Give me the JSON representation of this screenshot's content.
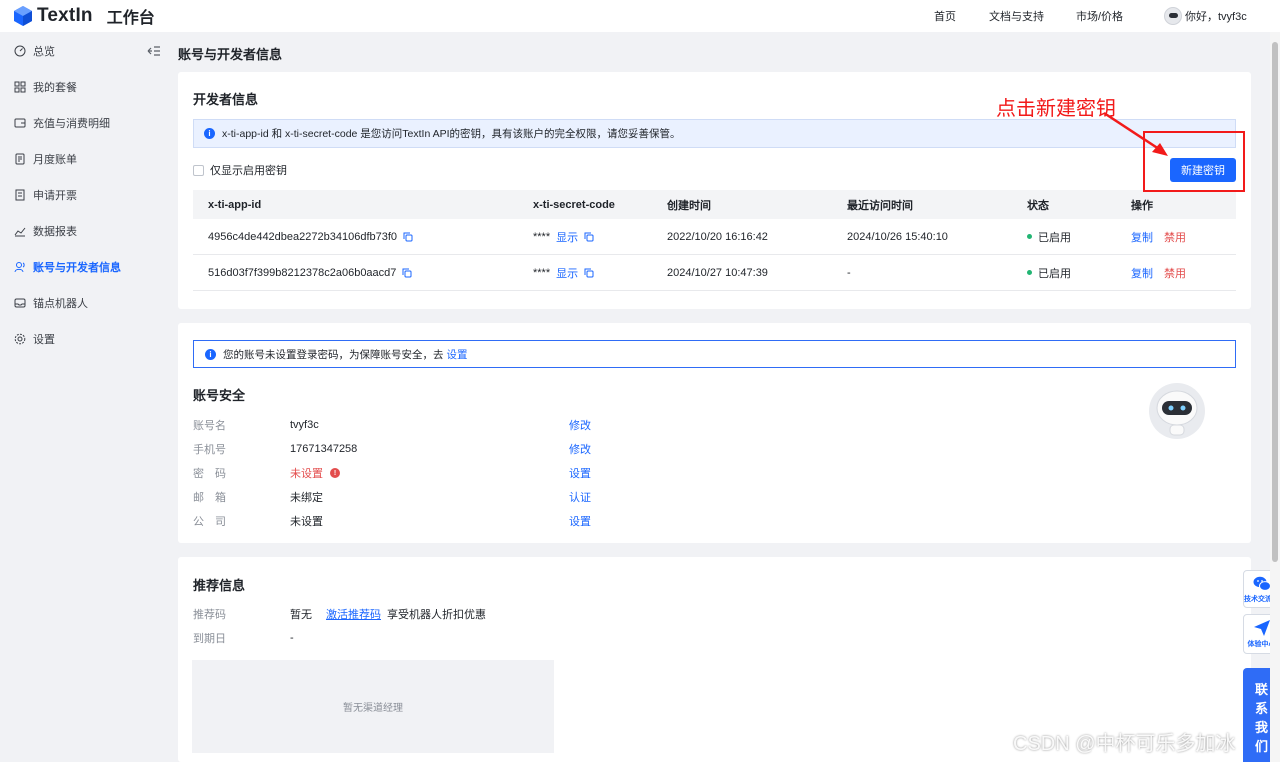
{
  "header": {
    "brand": "TextIn",
    "workspace": "工作台",
    "nav": {
      "home": "首页",
      "docs": "文档与支持",
      "market": "市场/价格"
    },
    "greeting": "你好，tvyf3c"
  },
  "sidebar": {
    "items": [
      {
        "label": "总览",
        "icon": "dashboard-icon"
      },
      {
        "label": "我的套餐",
        "icon": "grid-icon"
      },
      {
        "label": "充值与消费明细",
        "icon": "wallet-icon"
      },
      {
        "label": "月度账单",
        "icon": "bill-icon"
      },
      {
        "label": "申请开票",
        "icon": "invoice-icon"
      },
      {
        "label": "数据报表",
        "icon": "chart-icon"
      },
      {
        "label": "账号与开发者信息",
        "icon": "users-icon",
        "active": true
      },
      {
        "label": "锚点机器人",
        "icon": "inbox-icon"
      },
      {
        "label": "设置",
        "icon": "gear-icon"
      }
    ]
  },
  "page": {
    "title": "账号与开发者信息"
  },
  "developer": {
    "title": "开发者信息",
    "notice": "x-ti-app-id 和 x-ti-secret-code 是您访问TextIn API的密钥，具有该账户的完全权限，请您妥善保管。",
    "only_enabled_label": "仅显示启用密钥",
    "new_key_label": "新建密钥",
    "columns": [
      "x-ti-app-id",
      "x-ti-secret-code",
      "创建时间",
      "最近访问时间",
      "状态",
      "操作"
    ],
    "rows": [
      {
        "app_id": "4956c4de442dbea2272b34106dfb73f0",
        "secret": "****",
        "show": "显示",
        "created": "2022/10/20 16:16:42",
        "last_access": "2024/10/26 15:40:10",
        "status": "已启用",
        "copy": "复制",
        "disable": "禁用"
      },
      {
        "app_id": "516d03f7f399b8212378c2a06b0aacd7",
        "secret": "****",
        "show": "显示",
        "created": "2024/10/27 10:47:39",
        "last_access": "-",
        "status": "已启用",
        "copy": "复制",
        "disable": "禁用"
      }
    ]
  },
  "security": {
    "notice_text": "您的账号未设置登录密码，为保障账号安全，去",
    "notice_link": "设置",
    "title": "账号安全",
    "rows": [
      {
        "label": "账号名",
        "value": "tvyf3c",
        "action": "修改"
      },
      {
        "label": "手机号",
        "value": "17671347258",
        "action": "修改"
      },
      {
        "label": "密　码",
        "value": "未设置",
        "action": "设置",
        "warning": true
      },
      {
        "label": "邮　箱",
        "value": "未绑定",
        "action": "认证"
      },
      {
        "label": "公　司",
        "value": "未设置",
        "action": "设置"
      }
    ]
  },
  "referral": {
    "title": "推荐信息",
    "code_label": "推荐码",
    "code_value": "暂无",
    "activate_link": "激活推荐码",
    "activate_suffix": "享受机器人折扣优惠",
    "expire_label": "到期日",
    "expire_value": "-",
    "manager_empty": "暂无渠道经理"
  },
  "annotation": {
    "text": "点击新建密钥",
    "color": "#f21a1a"
  },
  "floating": {
    "wechat_label": "技术交流群",
    "experience_label": "体验中心",
    "contact_label": [
      "联",
      "系",
      "我",
      "们"
    ]
  },
  "watermark": "CSDN @中杯可乐多加冰",
  "colors": {
    "accent": "#1a66ff",
    "danger": "#e34d4d",
    "success": "#22b573"
  }
}
